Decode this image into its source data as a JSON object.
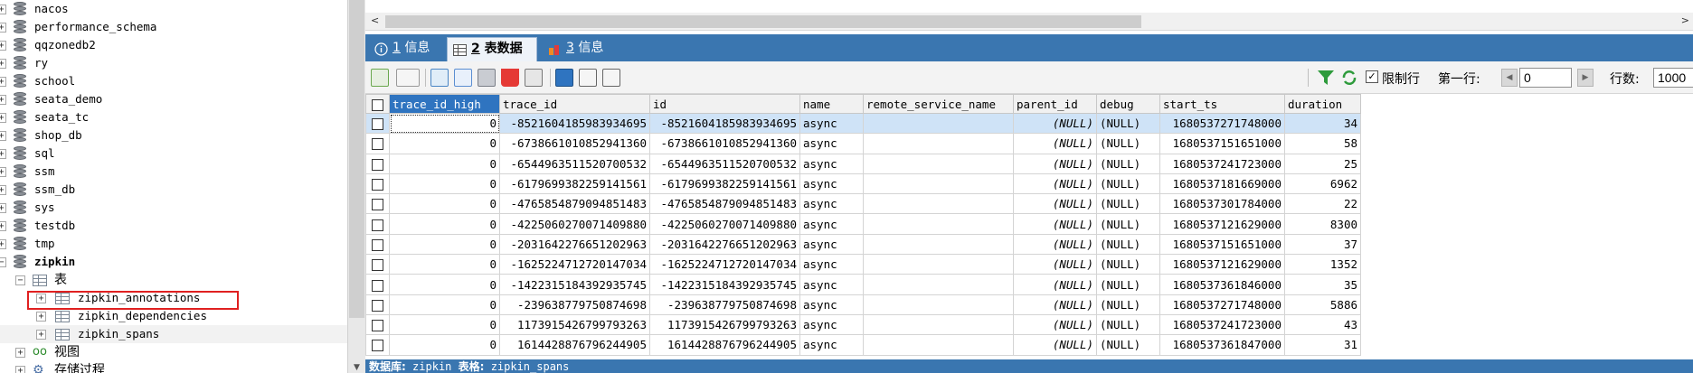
{
  "tree": {
    "databases": [
      "nacos",
      "performance_schema",
      "qqzonedb2",
      "ry",
      "school",
      "seata_demo",
      "seata_tc",
      "shop_db",
      "sql",
      "ssm",
      "ssm_db",
      "sys",
      "testdb",
      "tmp"
    ],
    "current_db": "zipkin",
    "tables_folder": "表",
    "tables": [
      "zipkin_annotations",
      "zipkin_dependencies",
      "zipkin_spans"
    ],
    "views_folder": "视图",
    "procs_folder": "存储过程"
  },
  "tabs": [
    {
      "num": "1",
      "label": "信息"
    },
    {
      "num": "2",
      "label": "表数据"
    },
    {
      "num": "3",
      "label": "信息"
    }
  ],
  "toolbar": {
    "limit_rows_label": "限制行",
    "first_row_label": "第一行:",
    "first_row_value": "0",
    "row_count_label": "行数:",
    "row_count_value": "1000"
  },
  "grid": {
    "columns": [
      "trace_id_high",
      "trace_id",
      "id",
      "name",
      "remote_service_name",
      "parent_id",
      "debug",
      "start_ts",
      "duration"
    ],
    "rows": [
      [
        "0",
        "-8521604185983934695",
        "-8521604185983934695",
        "async",
        "",
        "(NULL)",
        "(NULL)",
        "1680537271748000",
        "34"
      ],
      [
        "0",
        "-6738661010852941360",
        "-6738661010852941360",
        "async",
        "",
        "(NULL)",
        "(NULL)",
        "1680537151651000",
        "58"
      ],
      [
        "0",
        "-6544963511520700532",
        "-6544963511520700532",
        "async",
        "",
        "(NULL)",
        "(NULL)",
        "1680537241723000",
        "25"
      ],
      [
        "0",
        "-6179699382259141561",
        "-6179699382259141561",
        "async",
        "",
        "(NULL)",
        "(NULL)",
        "1680537181669000",
        "6962"
      ],
      [
        "0",
        "-4765854879094851483",
        "-4765854879094851483",
        "async",
        "",
        "(NULL)",
        "(NULL)",
        "1680537301784000",
        "22"
      ],
      [
        "0",
        "-4225060270071409880",
        "-4225060270071409880",
        "async",
        "",
        "(NULL)",
        "(NULL)",
        "1680537121629000",
        "8300"
      ],
      [
        "0",
        "-2031642276651202963",
        "-2031642276651202963",
        "async",
        "",
        "(NULL)",
        "(NULL)",
        "1680537151651000",
        "37"
      ],
      [
        "0",
        "-1625224712720147034",
        "-1625224712720147034",
        "async",
        "",
        "(NULL)",
        "(NULL)",
        "1680537121629000",
        "1352"
      ],
      [
        "0",
        "-1422315184392935745",
        "-1422315184392935745",
        "async",
        "",
        "(NULL)",
        "(NULL)",
        "1680537361846000",
        "35"
      ],
      [
        "0",
        "-239638779750874698",
        "-239638779750874698",
        "async",
        "",
        "(NULL)",
        "(NULL)",
        "1680537271748000",
        "5886"
      ],
      [
        "0",
        "1173915426799793263",
        "1173915426799793263",
        "async",
        "",
        "(NULL)",
        "(NULL)",
        "1680537241723000",
        "43"
      ],
      [
        "0",
        "1614428876796244905",
        "1614428876796244905",
        "async",
        "",
        "(NULL)",
        "(NULL)",
        "1680537361847000",
        "31"
      ]
    ]
  },
  "status": {
    "db_label": "数据库:",
    "db_value": "zipkin",
    "table_label": "表格:",
    "table_value": "zipkin_spans"
  },
  "colors": {
    "tab_bar": "#3a76b0",
    "selected_header": "#2f74c0",
    "highlight_box": "#e02020"
  }
}
